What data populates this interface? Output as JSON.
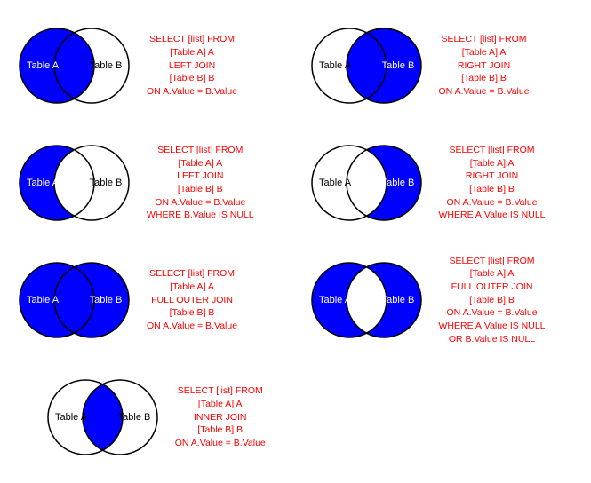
{
  "joins": [
    {
      "id": "left-join",
      "label": "LEFT JOIN",
      "sql": "SELECT [list] FROM\n[Table A] A\nLEFT JOIN\n[Table B] B\nON A.Value = B.Value",
      "highlight": "left",
      "position": "top-left"
    },
    {
      "id": "right-join",
      "label": "RIGHT JOIN",
      "sql": "SELECT [list] FROM\n[Table A] A\nRIGHT JOIN\n[Table B] B\nON A.Value = B.Value",
      "highlight": "right",
      "position": "top-right"
    },
    {
      "id": "left-join-null",
      "label": "LEFT JOIN WHERE B IS NULL",
      "sql": "SELECT [list] FROM\n[Table A] A\nLEFT JOIN\n[Table B] B\nON A.Value = B.Value\nWHERE B.Value IS NULL",
      "highlight": "left-only",
      "position": "mid-left"
    },
    {
      "id": "right-join-null",
      "label": "RIGHT JOIN WHERE A IS NULL",
      "sql": "SELECT [list] FROM\n[Table A] A\nRIGHT JOIN\n[Table B] B\nON A.Value = B.Value\nWHERE A.Value IS NULL",
      "highlight": "right-only",
      "position": "mid-right"
    },
    {
      "id": "full-outer-join",
      "label": "FULL OUTER JOIN",
      "sql": "SELECT [list] FROM\n[Table A] A\nFULL OUTER JOIN\n[Table B] B\nON A.Value = B.Value",
      "highlight": "both",
      "position": "bot-left"
    },
    {
      "id": "full-outer-join-null",
      "label": "FULL OUTER JOIN WHERE NULL",
      "sql": "SELECT [list] FROM\n[Table A] A\nFULL OUTER JOIN\n[Table B] B\nON A.Value = B.Value\nWHERE A.Value IS NULL\nOR B.Value IS NULL",
      "highlight": "outer-only",
      "position": "bot-right"
    },
    {
      "id": "inner-join",
      "label": "INNER JOIN",
      "sql": "SELECT [list] FROM\n[Table A] A\nINNER JOIN\n[Table B] B\nON A.Value = B.Value",
      "highlight": "intersection",
      "position": "last"
    }
  ],
  "tableA": "Table A",
  "tableB": "Table B"
}
